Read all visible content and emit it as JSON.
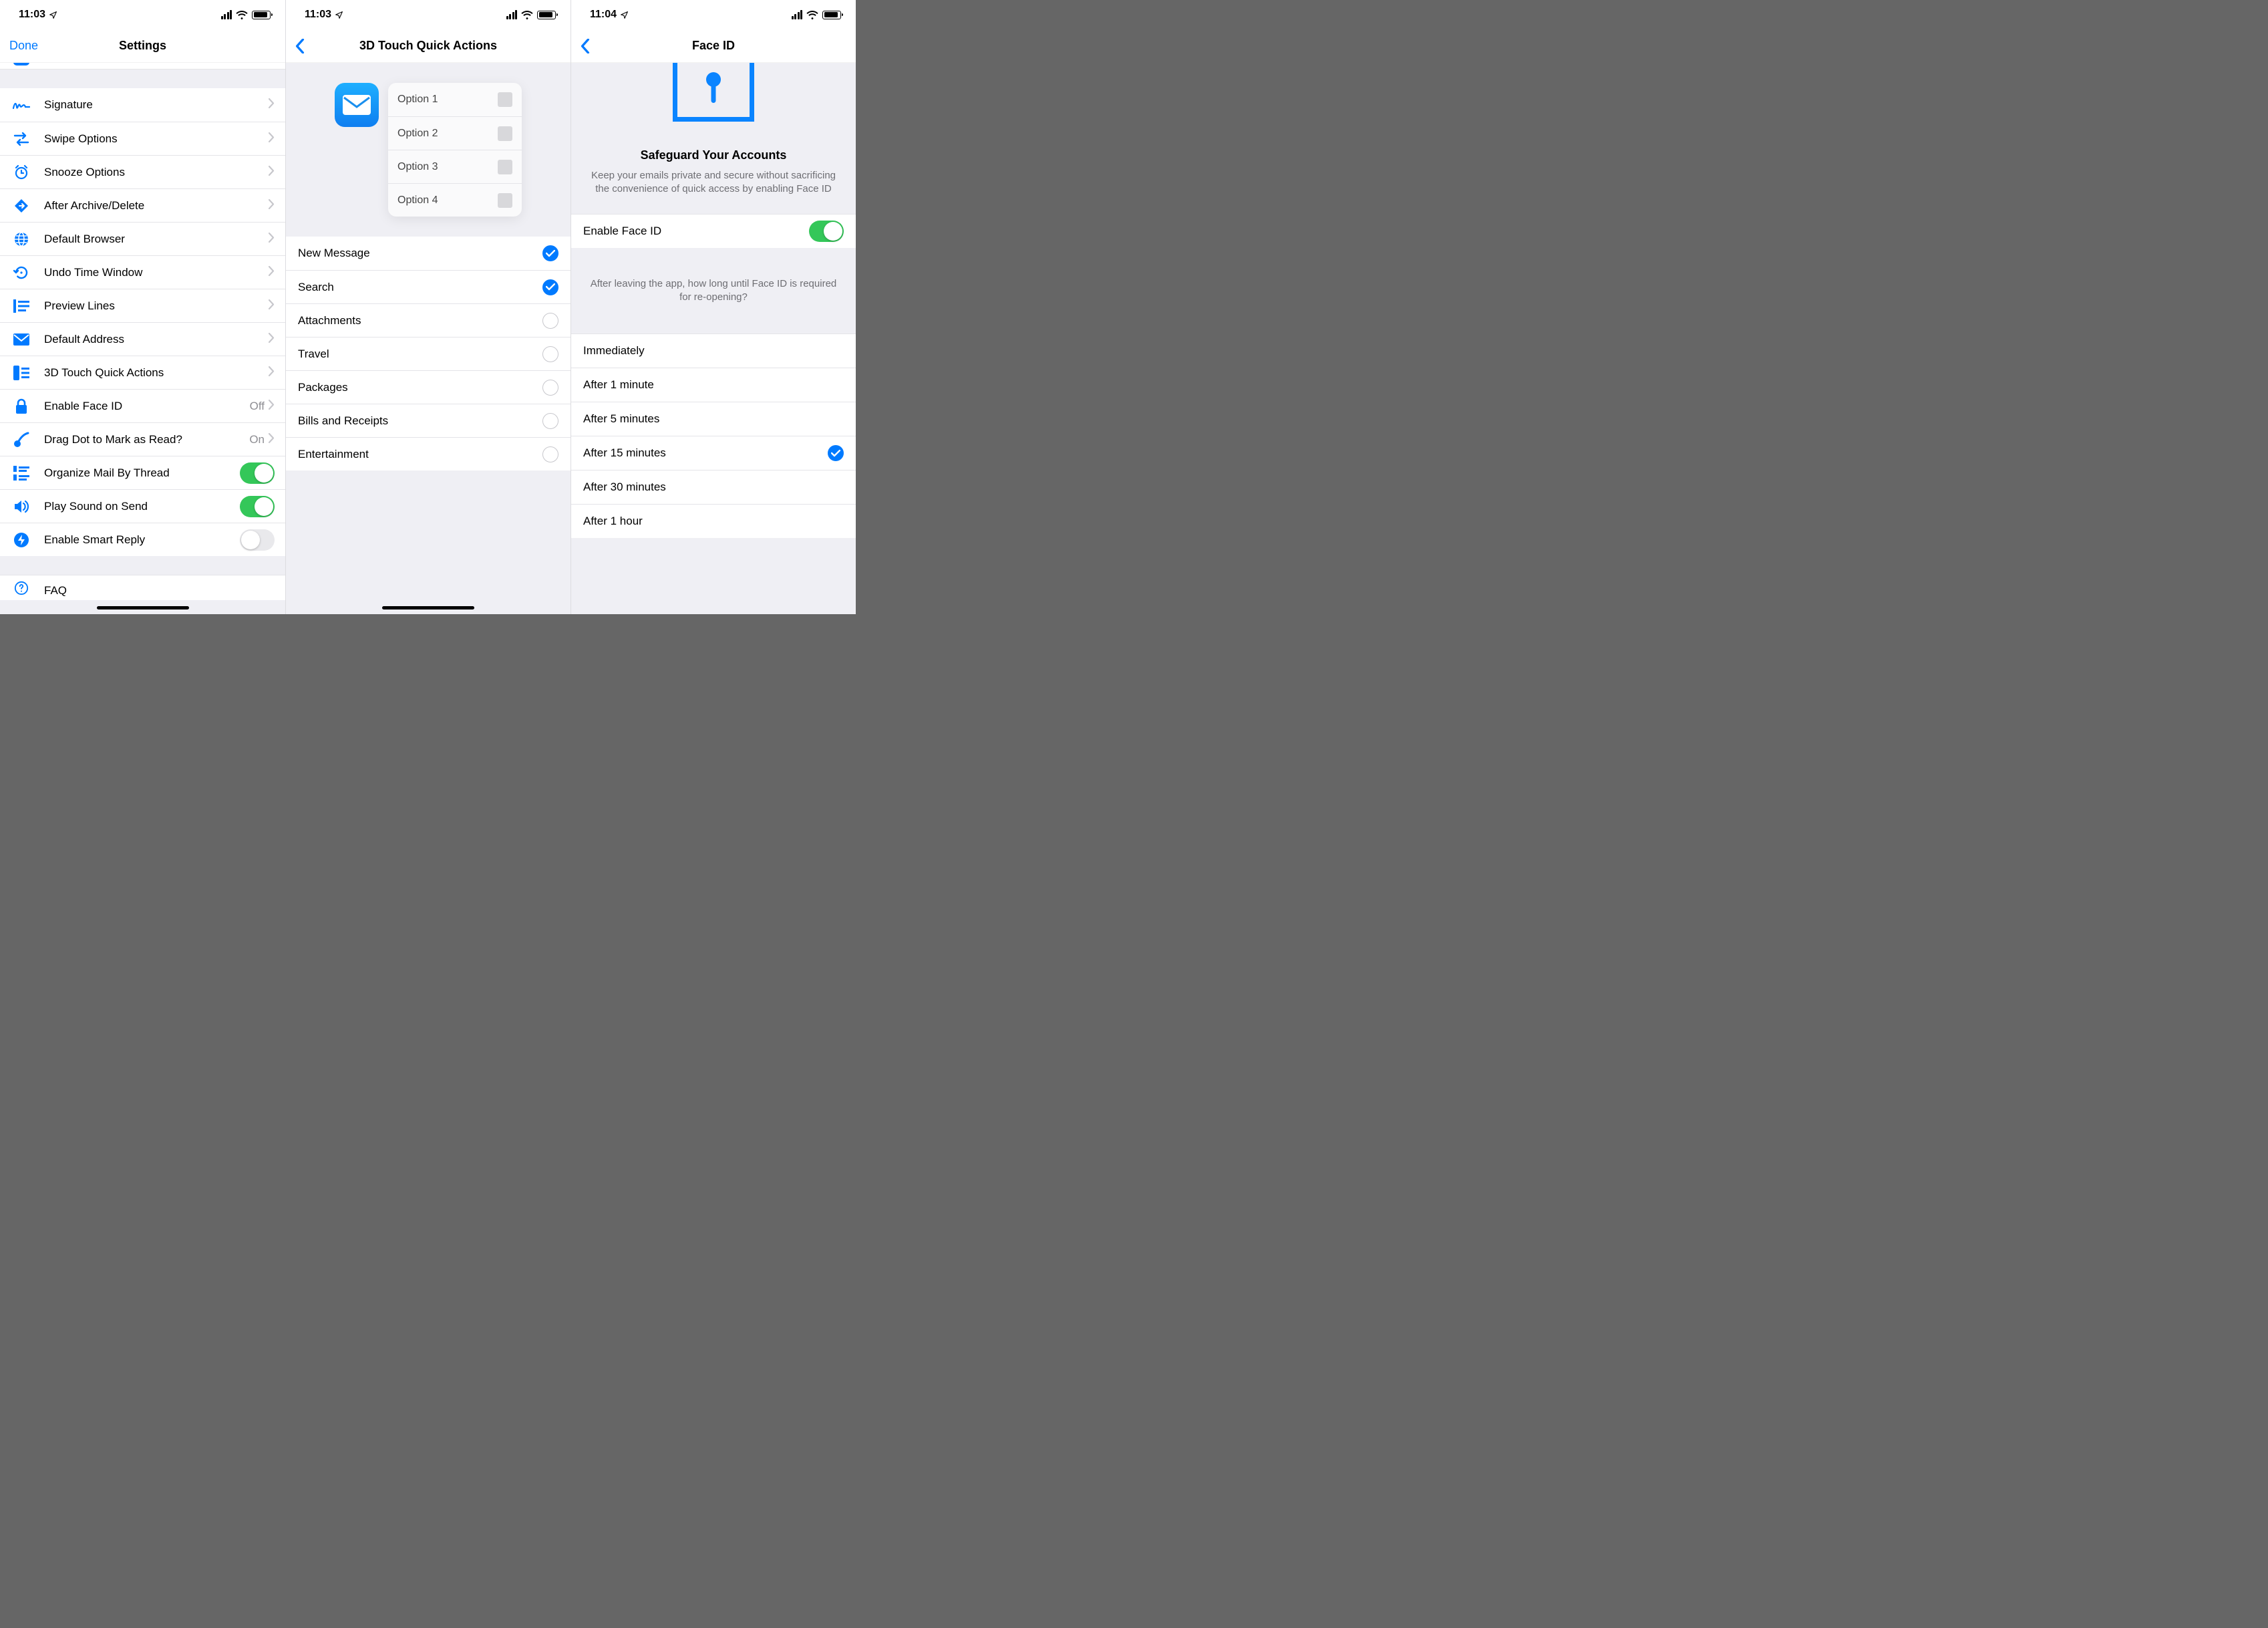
{
  "screen1": {
    "time": "11:03",
    "nav": {
      "left": "Done",
      "title": "Settings"
    },
    "rows": [
      {
        "icon": "signature-icon",
        "label": "Signature",
        "kind": "disclosure"
      },
      {
        "icon": "swap-arrows-icon",
        "label": "Swipe Options",
        "kind": "disclosure"
      },
      {
        "icon": "alarm-clock-icon",
        "label": "Snooze Options",
        "kind": "disclosure"
      },
      {
        "icon": "diamond-arrow-icon",
        "label": "After Archive/Delete",
        "kind": "disclosure"
      },
      {
        "icon": "globe-icon",
        "label": "Default Browser",
        "kind": "disclosure"
      },
      {
        "icon": "undo-clock-icon",
        "label": "Undo Time Window",
        "kind": "disclosure"
      },
      {
        "icon": "preview-lines-icon",
        "label": "Preview Lines",
        "kind": "disclosure"
      },
      {
        "icon": "envelope-icon",
        "label": "Default Address",
        "kind": "disclosure"
      },
      {
        "icon": "quick-actions-icon",
        "label": "3D Touch Quick Actions",
        "kind": "disclosure"
      },
      {
        "icon": "lock-icon",
        "label": "Enable Face ID",
        "kind": "disclosure",
        "value": "Off"
      },
      {
        "icon": "drag-dot-icon",
        "label": "Drag Dot to Mark as Read?",
        "kind": "disclosure",
        "value": "On"
      },
      {
        "icon": "thread-icon",
        "label": "Organize Mail By Thread",
        "kind": "toggle",
        "toggled": true
      },
      {
        "icon": "speaker-icon",
        "label": "Play Sound on Send",
        "kind": "toggle",
        "toggled": true
      },
      {
        "icon": "bolt-circle-icon",
        "label": "Enable Smart Reply",
        "kind": "toggle",
        "toggled": false
      }
    ],
    "faq_label": "FAQ"
  },
  "screen2": {
    "time": "11:03",
    "nav": {
      "title": "3D Touch Quick Actions"
    },
    "preview_options": [
      "Option 1",
      "Option 2",
      "Option 3",
      "Option 4"
    ],
    "items": [
      {
        "label": "New Message",
        "selected": true
      },
      {
        "label": "Search",
        "selected": true
      },
      {
        "label": "Attachments",
        "selected": false
      },
      {
        "label": "Travel",
        "selected": false
      },
      {
        "label": "Packages",
        "selected": false
      },
      {
        "label": "Bills and Receipts",
        "selected": false
      },
      {
        "label": "Entertainment",
        "selected": false
      }
    ]
  },
  "screen3": {
    "time": "11:04",
    "nav": {
      "title": "Face ID"
    },
    "hero_title": "Safeguard Your Accounts",
    "hero_desc": "Keep your emails private and secure without sacrificing the convenience of quick access by enabling Face ID",
    "enable_label": "Enable Face ID",
    "enable_on": true,
    "section_desc": "After leaving the app, how long until Face ID is required for re-opening?",
    "options": [
      {
        "label": "Immediately",
        "selected": false
      },
      {
        "label": "After 1 minute",
        "selected": false
      },
      {
        "label": "After 5 minutes",
        "selected": false
      },
      {
        "label": "After 15 minutes",
        "selected": true
      },
      {
        "label": "After 30 minutes",
        "selected": false
      },
      {
        "label": "After 1 hour",
        "selected": false
      }
    ]
  }
}
